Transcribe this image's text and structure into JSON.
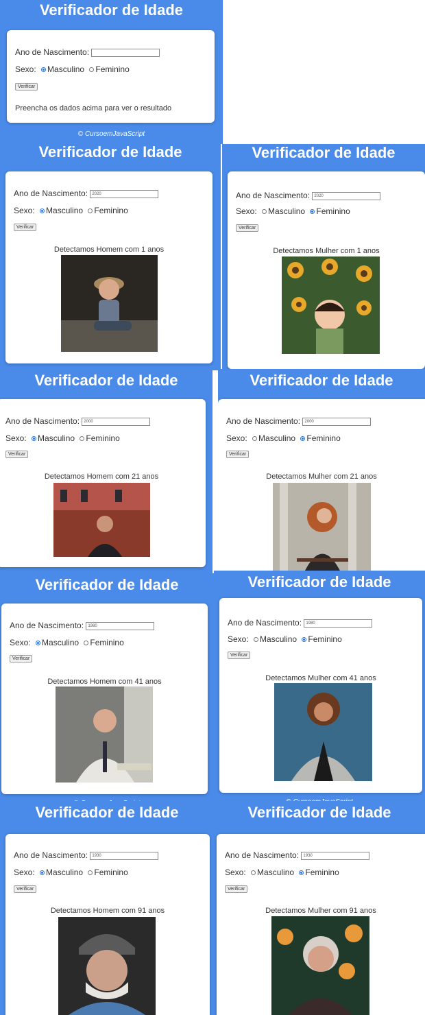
{
  "app": {
    "title": "Verificador de Idade",
    "footer": "© CursoemJavaScript",
    "year_label": "Ano de Nascimento:",
    "sex_label": "Sexo:",
    "male_label": "Masculino",
    "female_label": "Feminino",
    "verify_button": "Verificar",
    "empty_message": "Preencha os dados acima para ver o resultado"
  },
  "colors": {
    "header_bg": "#4a8ae8",
    "card_bg": "#ffffff",
    "radio_accent": "#2a6fe0"
  },
  "panels": [
    {
      "id": "initial",
      "year": "",
      "sex": "none",
      "result": ""
    },
    {
      "id": "male-2020",
      "year": "2020",
      "sex": "male",
      "result": "Detectamos Homem com 1 anos",
      "photo": "baby-boy-photo"
    },
    {
      "id": "female-2020",
      "year": "2020",
      "sex": "female",
      "result": "Detectamos Mulher com 1 anos",
      "photo": "baby-girl-photo"
    },
    {
      "id": "male-2000",
      "year": "2000",
      "sex": "male",
      "result": "Detectamos Homem com 21 anos",
      "photo": "young-man-photo"
    },
    {
      "id": "female-2000",
      "year": "2000",
      "sex": "female",
      "result": "Detectamos Mulher com 21 anos",
      "photo": "young-woman-photo"
    },
    {
      "id": "male-1980",
      "year": "1980",
      "sex": "male",
      "result": "Detectamos Homem com 41 anos",
      "photo": "adult-man-photo"
    },
    {
      "id": "female-1980",
      "year": "1980",
      "sex": "female",
      "result": "Detectamos Mulher com 41 anos",
      "photo": "adult-woman-photo"
    },
    {
      "id": "male-1930",
      "year": "1930",
      "sex": "male",
      "result": "Detectamos Homem com 91 anos",
      "photo": "old-man-photo"
    },
    {
      "id": "female-1930",
      "year": "1930",
      "sex": "female",
      "result": "Detectamos Mulher com 91 anos",
      "photo": "old-woman-photo"
    }
  ]
}
